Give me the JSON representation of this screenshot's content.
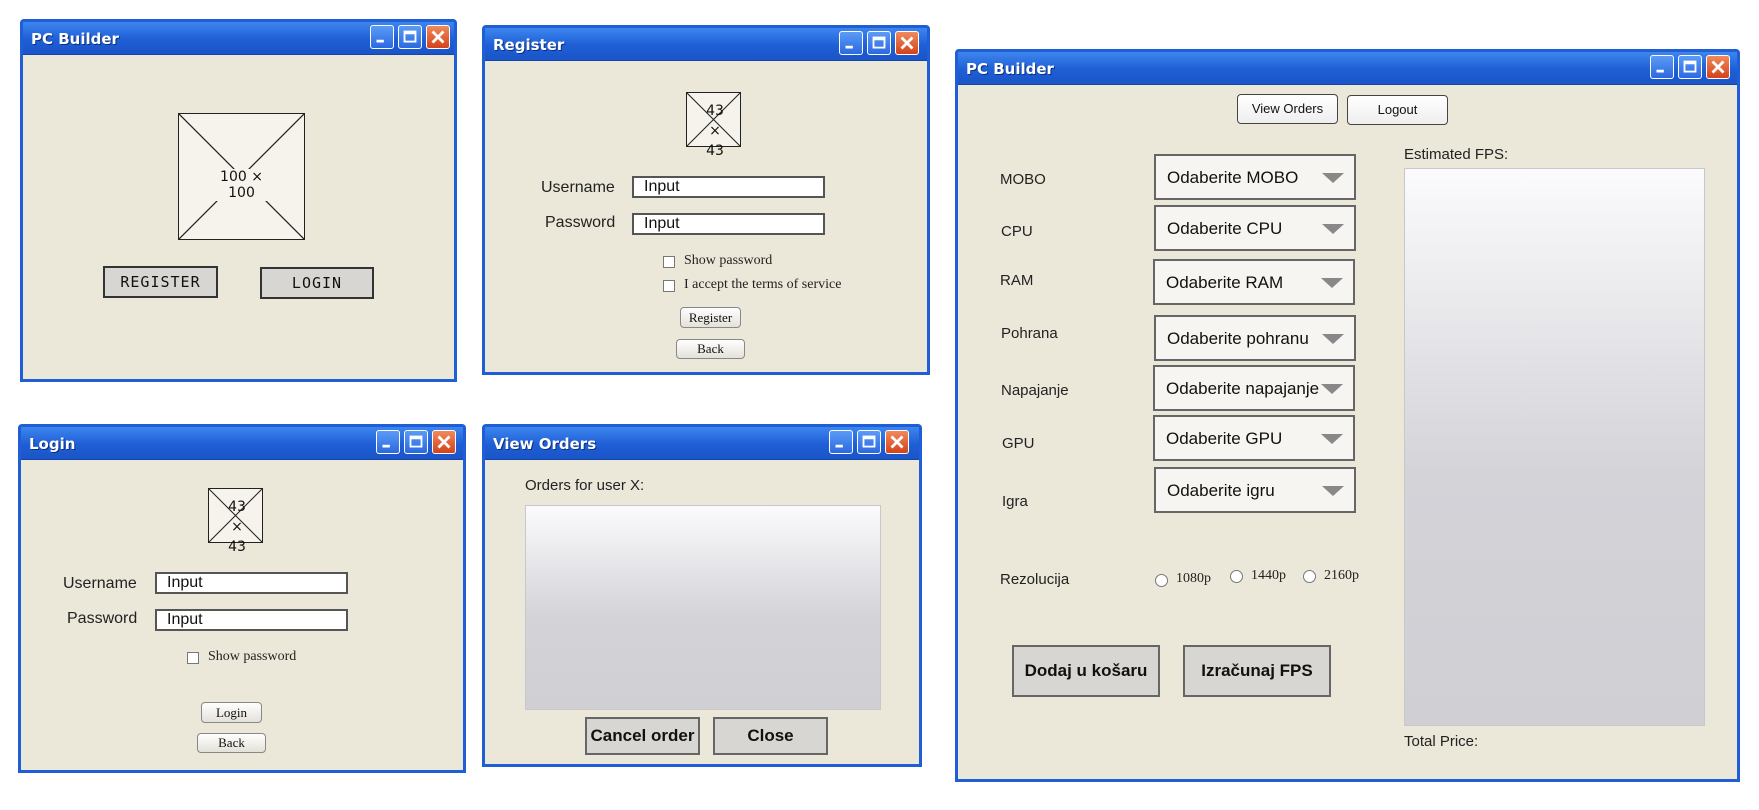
{
  "windows": {
    "main_start": {
      "title": "PC Builder",
      "placeholder_image": "100 × 100",
      "register_label": "REGISTER",
      "login_label": "LOGIN"
    },
    "register": {
      "title": "Register",
      "placeholder_image": "43 × 43",
      "username_label": "Username",
      "username_value": "Input",
      "password_label": "Password",
      "password_value": "Input",
      "show_password_label": "Show password",
      "terms_label": "I accept the terms of service",
      "register_button": "Register",
      "back_button": "Back"
    },
    "login": {
      "title": "Login",
      "placeholder_image": "43 × 43",
      "username_label": "Username",
      "username_value": "Input",
      "password_label": "Password",
      "password_value": "Input",
      "show_password_label": "Show password",
      "login_button": "Login",
      "back_button": "Back"
    },
    "view_orders": {
      "title": "View Orders",
      "orders_label": "Orders for user X:",
      "cancel_button": "Cancel order",
      "close_button": "Close"
    },
    "builder": {
      "title": "PC Builder",
      "view_orders_button": "View Orders",
      "logout_button": "Logout",
      "estimated_fps_label": "Estimated FPS:",
      "total_price_label": "Total Price:",
      "components": [
        {
          "label": "MOBO",
          "select": "Odaberite MOBO"
        },
        {
          "label": "CPU",
          "select": "Odaberite CPU"
        },
        {
          "label": "RAM",
          "select": "Odaberite RAM"
        },
        {
          "label": "Pohrana",
          "select": "Odaberite pohranu"
        },
        {
          "label": "Napajanje",
          "select": "Odaberite napajanje"
        },
        {
          "label": "GPU",
          "select": "Odaberite GPU"
        },
        {
          "label": "Igra",
          "select": "Odaberite igru"
        }
      ],
      "resolution_label": "Rezolucija",
      "resolutions": [
        "1080p",
        "1440p",
        "2160p"
      ],
      "add_to_cart_button": "Dodaj u košaru",
      "calculate_fps_button": "Izračunaj FPS"
    }
  },
  "colors": {
    "window_border": "#1f5ed6",
    "window_background": "#ebe7d9",
    "close_button": "#d4421a"
  },
  "icons": [
    "minimize-icon",
    "maximize-icon",
    "close-icon",
    "dropdown-arrow-icon",
    "image-placeholder-icon"
  ]
}
